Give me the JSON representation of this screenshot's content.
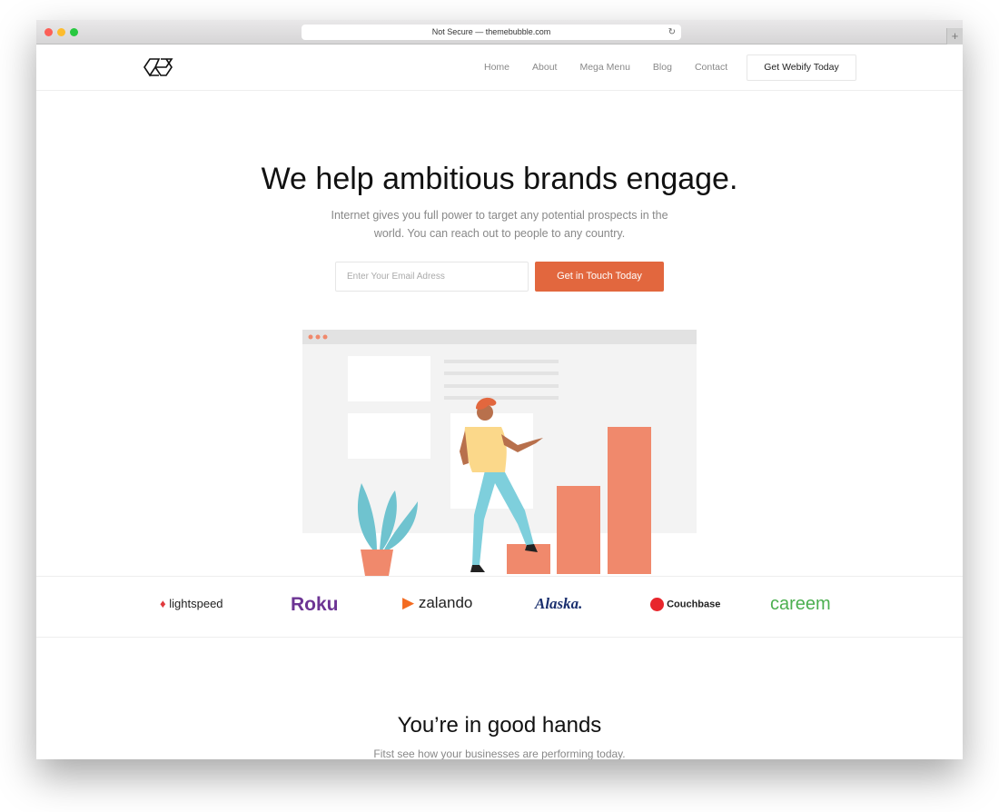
{
  "browser": {
    "url": "Not Secure — themebubble.com"
  },
  "nav": {
    "links": [
      "Home",
      "About",
      "Mega Menu",
      "Blog",
      "Contact"
    ],
    "cta": "Get Webify Today"
  },
  "hero": {
    "title": "We help ambitious brands engage.",
    "subtitle": "Internet gives you full power to target any potential prospects in the world. You can reach out to people to any country.",
    "email_placeholder": "Enter Your Email Adress",
    "button": "Get in Touch Today"
  },
  "brands": [
    "lightspeed",
    "Roku",
    "zalando",
    "Alaska.",
    "Couchbase",
    "careem"
  ],
  "section": {
    "title": "You’re in good hands",
    "subtitle": "Fitst see how your businesses are performing today."
  },
  "colors": {
    "accent": "#e2673e",
    "bars": "#f0896c"
  }
}
